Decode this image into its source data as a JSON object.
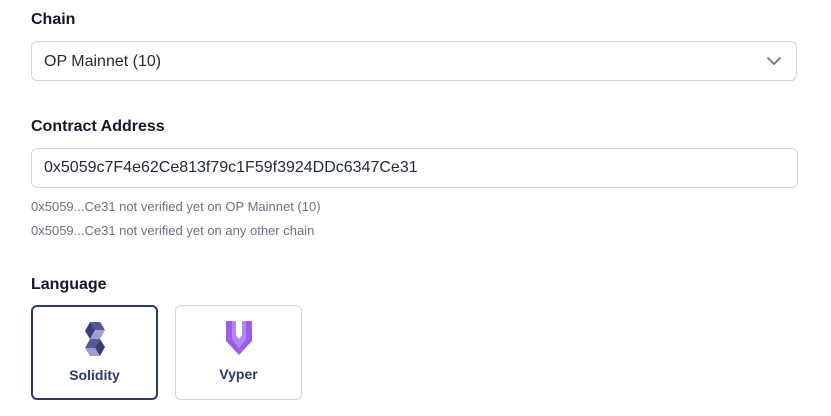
{
  "chain": {
    "label": "Chain",
    "selected": "OP Mainnet (10)",
    "icon": "chevron-down-icon"
  },
  "contract": {
    "label": "Contract Address",
    "value": "0x5059c7F4e62Ce813f79c1F59f3924DDc6347Ce31",
    "status": [
      "0x5059...Ce31 not verified yet on OP Mainnet (10)",
      "0x5059...Ce31 not verified yet on any other chain"
    ]
  },
  "language": {
    "label": "Language",
    "options": [
      {
        "name": "Solidity",
        "icon": "solidity-icon",
        "selected": true
      },
      {
        "name": "Vyper",
        "icon": "vyper-icon",
        "selected": false
      }
    ]
  },
  "colors": {
    "selected_border": "#2b3a67",
    "label_text": "#2b3a67",
    "vyper_purple": "#8b5cf6",
    "solidity_dark": "#3d3a78",
    "muted_text": "#6b7280"
  }
}
